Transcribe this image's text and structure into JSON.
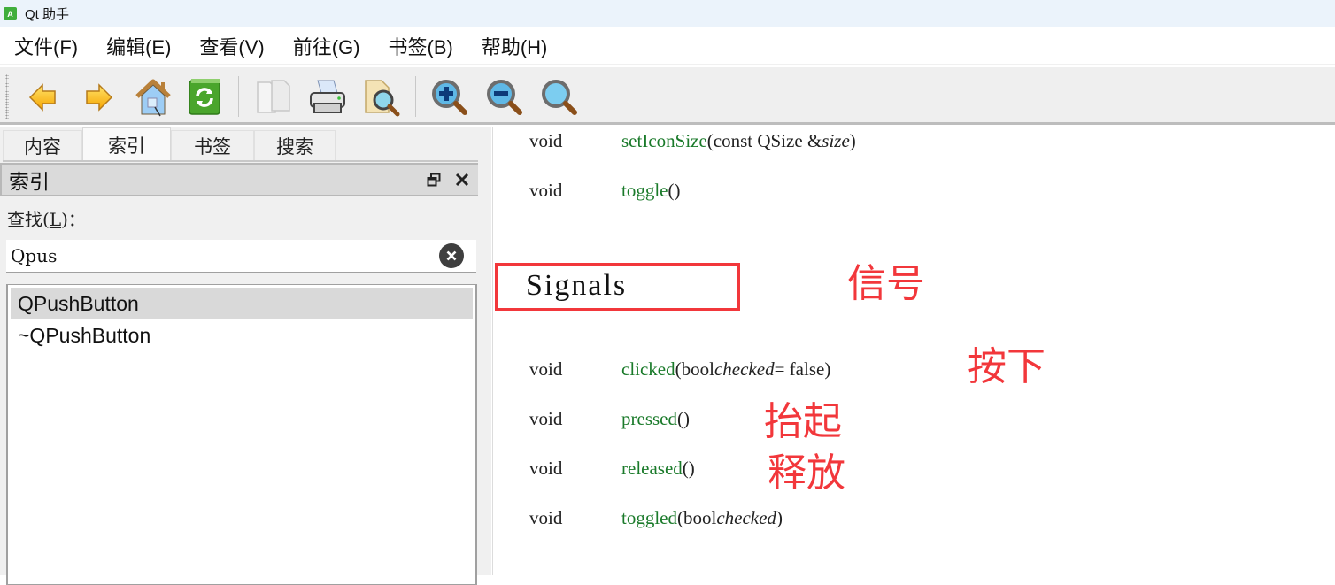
{
  "window": {
    "title": "Qt 助手",
    "app_icon_letter": "A"
  },
  "menubar": {
    "items": [
      {
        "label": "文件(F)"
      },
      {
        "label": "编辑(E)"
      },
      {
        "label": "查看(V)"
      },
      {
        "label": "前往(G)"
      },
      {
        "label": "书签(B)"
      },
      {
        "label": "帮助(H)"
      }
    ]
  },
  "toolbar": {
    "buttons": [
      {
        "icon": "back-arrow-icon"
      },
      {
        "icon": "forward-arrow-icon"
      },
      {
        "icon": "home-icon"
      },
      {
        "icon": "sync-contents-icon"
      },
      {
        "icon": "copy-icon"
      },
      {
        "icon": "print-icon"
      },
      {
        "icon": "find-in-page-icon"
      },
      {
        "icon": "zoom-in-icon"
      },
      {
        "icon": "zoom-out-icon"
      },
      {
        "icon": "reset-zoom-icon"
      }
    ]
  },
  "sidebar": {
    "tabs": [
      {
        "label": "内容",
        "active": false
      },
      {
        "label": "索引",
        "active": true
      },
      {
        "label": "书签",
        "active": false
      },
      {
        "label": "搜索",
        "active": false
      }
    ],
    "dock_title": "索引",
    "find_label_prefix": "查找(",
    "find_label_mnemonic": "L",
    "find_label_suffix": ")：",
    "search_value": "Qpus",
    "results": [
      {
        "label": "QPushButton",
        "selected": true
      },
      {
        "label": "~QPushButton",
        "selected": false
      }
    ]
  },
  "content": {
    "functions_top": [
      {
        "type": "void",
        "name": "setIconSize",
        "params_before": "(const QSize &",
        "param_italic": "size",
        "params_after": ")"
      },
      {
        "type": "void",
        "name": "toggle",
        "params_before": "()",
        "param_italic": "",
        "params_after": ""
      }
    ],
    "section_heading": "Signals",
    "signals": [
      {
        "type": "void",
        "name": "clicked",
        "params_before": "(bool ",
        "param_italic": "checked",
        "params_after": " = false)"
      },
      {
        "type": "void",
        "name": "pressed",
        "params_before": "()",
        "param_italic": "",
        "params_after": ""
      },
      {
        "type": "void",
        "name": "released",
        "params_before": "()",
        "param_italic": "",
        "params_after": ""
      },
      {
        "type": "void",
        "name": "toggled",
        "params_before": "(bool ",
        "param_italic": "checked",
        "params_after": ")"
      }
    ],
    "annotations": {
      "signals": "信号",
      "clicked": "按下",
      "pressed": "抬起",
      "released": "释放"
    },
    "colors": {
      "annotation_red": "#f2373b",
      "function_green": "#1a7a2a"
    }
  }
}
